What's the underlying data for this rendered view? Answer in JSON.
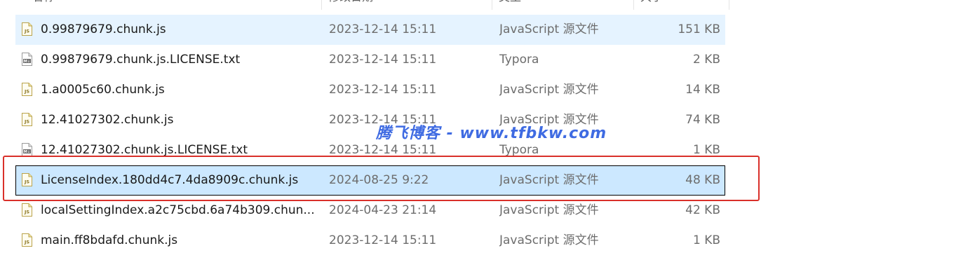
{
  "header": {
    "name": "名称",
    "date": "修改日期",
    "type": "类型",
    "size": "大小"
  },
  "files": [
    {
      "name": "0.99879679.chunk.js",
      "date": "2023-12-14 15:11",
      "type": "JavaScript 源文件",
      "size": "151 KB",
      "icon": "js-file-icon",
      "state": "hover"
    },
    {
      "name": "0.99879679.chunk.js.LICENSE.txt",
      "date": "2023-12-14 15:11",
      "type": "Typora",
      "size": "2 KB",
      "icon": "markdown-file-icon",
      "state": "normal"
    },
    {
      "name": "1.a0005c60.chunk.js",
      "date": "2023-12-14 15:11",
      "type": "JavaScript 源文件",
      "size": "14 KB",
      "icon": "js-file-icon",
      "state": "normal"
    },
    {
      "name": "12.41027302.chunk.js",
      "date": "2023-12-14 15:11",
      "type": "JavaScript 源文件",
      "size": "74 KB",
      "icon": "js-file-icon",
      "state": "normal"
    },
    {
      "name": "12.41027302.chunk.js.LICENSE.txt",
      "date": "2023-12-14 15:11",
      "type": "Typora",
      "size": "1 KB",
      "icon": "markdown-file-icon",
      "state": "normal"
    },
    {
      "name": "LicenseIndex.180dd4c7.4da8909c.chunk.js",
      "date": "2024-08-25 9:22",
      "type": "JavaScript 源文件",
      "size": "48 KB",
      "icon": "js-file-icon",
      "state": "selected"
    },
    {
      "name": "localSettingIndex.a2c75cbd.6a74b309.chun...",
      "date": "2024-04-23 21:14",
      "type": "JavaScript 源文件",
      "size": "42 KB",
      "icon": "js-file-icon",
      "state": "normal"
    },
    {
      "name": "main.ff8bdafd.chunk.js",
      "date": "2023-12-14 15:11",
      "type": "JavaScript 源文件",
      "size": "1 KB",
      "icon": "js-file-icon",
      "state": "normal"
    }
  ],
  "watermark": "腾飞博客 - www.tfbkw.com",
  "colors": {
    "hover_bg": "#e5f3ff",
    "selected_bg": "#cce8ff",
    "annotation_red": "#d9302a",
    "watermark_blue": "#2f5fe0"
  }
}
